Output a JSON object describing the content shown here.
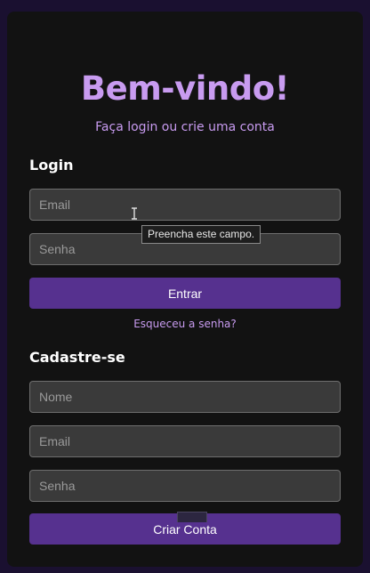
{
  "header": {
    "title": "Bem-vindo!",
    "subtitle": "Faça login ou crie uma conta"
  },
  "login": {
    "heading": "Login",
    "email_placeholder": "Email",
    "password_placeholder": "Senha",
    "submit_label": "Entrar",
    "forgot_label": "Esqueceu a senha?"
  },
  "signup": {
    "heading": "Cadastre-se",
    "name_placeholder": "Nome",
    "email_placeholder": "Email",
    "password_placeholder": "Senha",
    "submit_label": "Criar Conta"
  },
  "tooltip": {
    "text": "Preencha este campo."
  },
  "colors": {
    "accent": "#c89bf0",
    "button": "#56318f",
    "card_background": "#121212",
    "page_background": "#1a1030"
  },
  "icons": {
    "cursor": "text-cursor-icon"
  }
}
